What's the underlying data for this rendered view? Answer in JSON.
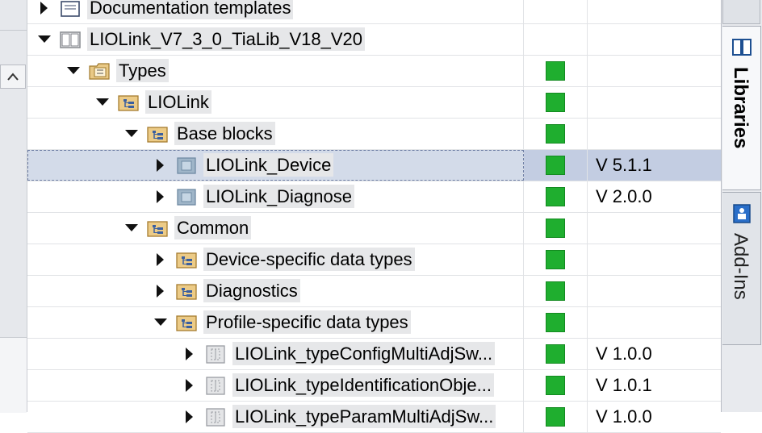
{
  "window": {
    "title": "Libraries"
  },
  "colors": {
    "status_ok": "#1fae2f",
    "selection": "#c3cde2"
  },
  "tree": {
    "rows": [
      {
        "label": "Documentation templates",
        "level": 0,
        "expanded": false,
        "icon": "documentation-folder-icon",
        "status": "",
        "version": ""
      },
      {
        "label": "LIOLink_V7_3_0_TiaLib_V18_V20",
        "level": 0,
        "expanded": true,
        "icon": "library-book-icon",
        "status": "",
        "version": ""
      },
      {
        "label": "Types",
        "level": 1,
        "expanded": true,
        "icon": "types-folder-icon",
        "status": "ok",
        "version": ""
      },
      {
        "label": "LIOLink",
        "level": 2,
        "expanded": true,
        "icon": "folder-icon",
        "status": "ok",
        "version": ""
      },
      {
        "label": "Base blocks",
        "level": 3,
        "expanded": true,
        "icon": "folder-icon",
        "status": "ok",
        "version": ""
      },
      {
        "label": "LIOLink_Device",
        "level": 4,
        "expanded": false,
        "icon": "function-block-icon",
        "status": "ok",
        "version": "V 5.1.1",
        "selected": true
      },
      {
        "label": "LIOLink_Diagnose",
        "level": 4,
        "expanded": false,
        "icon": "function-block-icon",
        "status": "ok",
        "version": "V 2.0.0"
      },
      {
        "label": "Common",
        "level": 3,
        "expanded": true,
        "icon": "folder-icon",
        "status": "ok",
        "version": ""
      },
      {
        "label": "Device-specific data types",
        "level": 4,
        "expanded": false,
        "icon": "folder-icon",
        "status": "ok",
        "version": ""
      },
      {
        "label": "Diagnostics",
        "level": 4,
        "expanded": false,
        "icon": "folder-icon",
        "status": "ok",
        "version": ""
      },
      {
        "label": "Profile-specific data types",
        "level": 4,
        "expanded": true,
        "icon": "folder-icon",
        "status": "ok",
        "version": ""
      },
      {
        "label": "LIOLink_typeConfigMultiAdjSw...",
        "level": 5,
        "expanded": false,
        "icon": "data-type-icon",
        "status": "ok",
        "version": "V 1.0.0"
      },
      {
        "label": "LIOLink_typeIdentificationObje...",
        "level": 5,
        "expanded": false,
        "icon": "data-type-icon",
        "status": "ok",
        "version": "V 1.0.1"
      },
      {
        "label": "LIOLink_typeParamMultiAdjSw...",
        "level": 5,
        "expanded": false,
        "icon": "data-type-icon",
        "status": "ok",
        "version": "V 1.0.0"
      }
    ]
  },
  "side_tabs": {
    "libraries": {
      "label": "Libraries",
      "icon": "libraries-book-icon"
    },
    "addins": {
      "label": "Add-Ins",
      "icon": "add-ins-icon"
    }
  },
  "left_strip": {
    "scroll_icon": "chevron-up-icon"
  }
}
